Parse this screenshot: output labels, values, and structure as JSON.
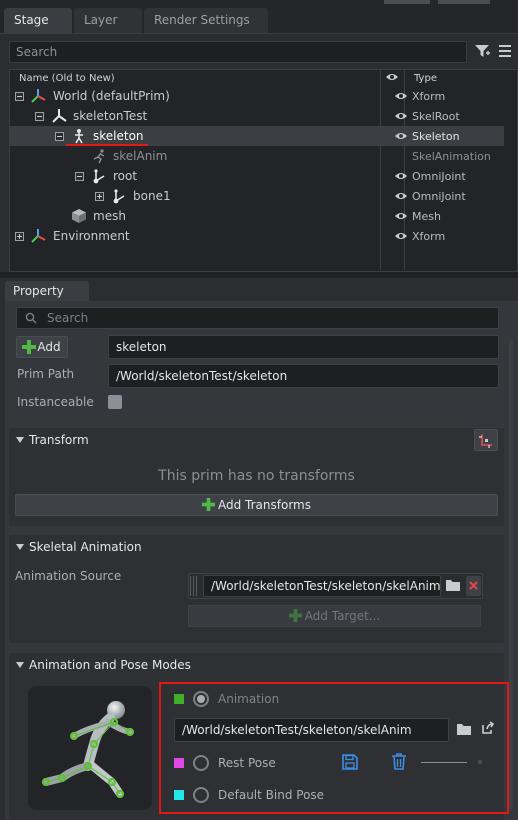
{
  "stage_tabs": [
    "Stage",
    "Layer",
    "Render Settings"
  ],
  "stage_search_placeholder": "Search",
  "tree_columns": {
    "name": "Name (Old to New)",
    "type": "Type"
  },
  "tree_rows": [
    {
      "name": "World (defaultPrim)",
      "type": "Xform",
      "eye": true
    },
    {
      "name": "skeletonTest",
      "type": "SkelRoot",
      "eye": true
    },
    {
      "name": "skeleton",
      "type": "Skeleton",
      "eye": true
    },
    {
      "name": "skelAnim",
      "type": "SkelAnimation",
      "eye": false
    },
    {
      "name": "root",
      "type": "OmniJoint",
      "eye": true
    },
    {
      "name": "bone1",
      "type": "OmniJoint",
      "eye": true
    },
    {
      "name": "mesh",
      "type": "Mesh",
      "eye": true
    },
    {
      "name": "Environment",
      "type": "Xform",
      "eye": true
    }
  ],
  "property": {
    "tab": "Property",
    "search_placeholder": "Search",
    "add_label": "Add",
    "prim_name": "skeleton",
    "prim_path_label": "Prim Path",
    "prim_path": "/World/skeletonTest/skeleton",
    "instanceable_label": "Instanceable"
  },
  "transform": {
    "title": "Transform",
    "empty_message": "This prim has no transforms",
    "add_button": "Add Transforms"
  },
  "skeletal_animation": {
    "title": "Skeletal Animation",
    "source_label": "Animation Source",
    "source_value": "/World/skeletonTest/skeleton/skelAnim",
    "add_target": "Add Target..."
  },
  "anim_pose": {
    "title": "Animation and Pose Modes",
    "animation_label": "Animation",
    "animation_path": "/World/skeletonTest/skeleton/skelAnim",
    "rest_pose_label": "Rest Pose",
    "bind_pose_label": "Default Bind Pose",
    "colors": {
      "animation": "#3fae29",
      "rest_pose": "#e048e8",
      "bind_pose": "#22e8e8"
    }
  },
  "colors": {
    "highlight": "#e01818",
    "accent_green": "#52b848"
  }
}
